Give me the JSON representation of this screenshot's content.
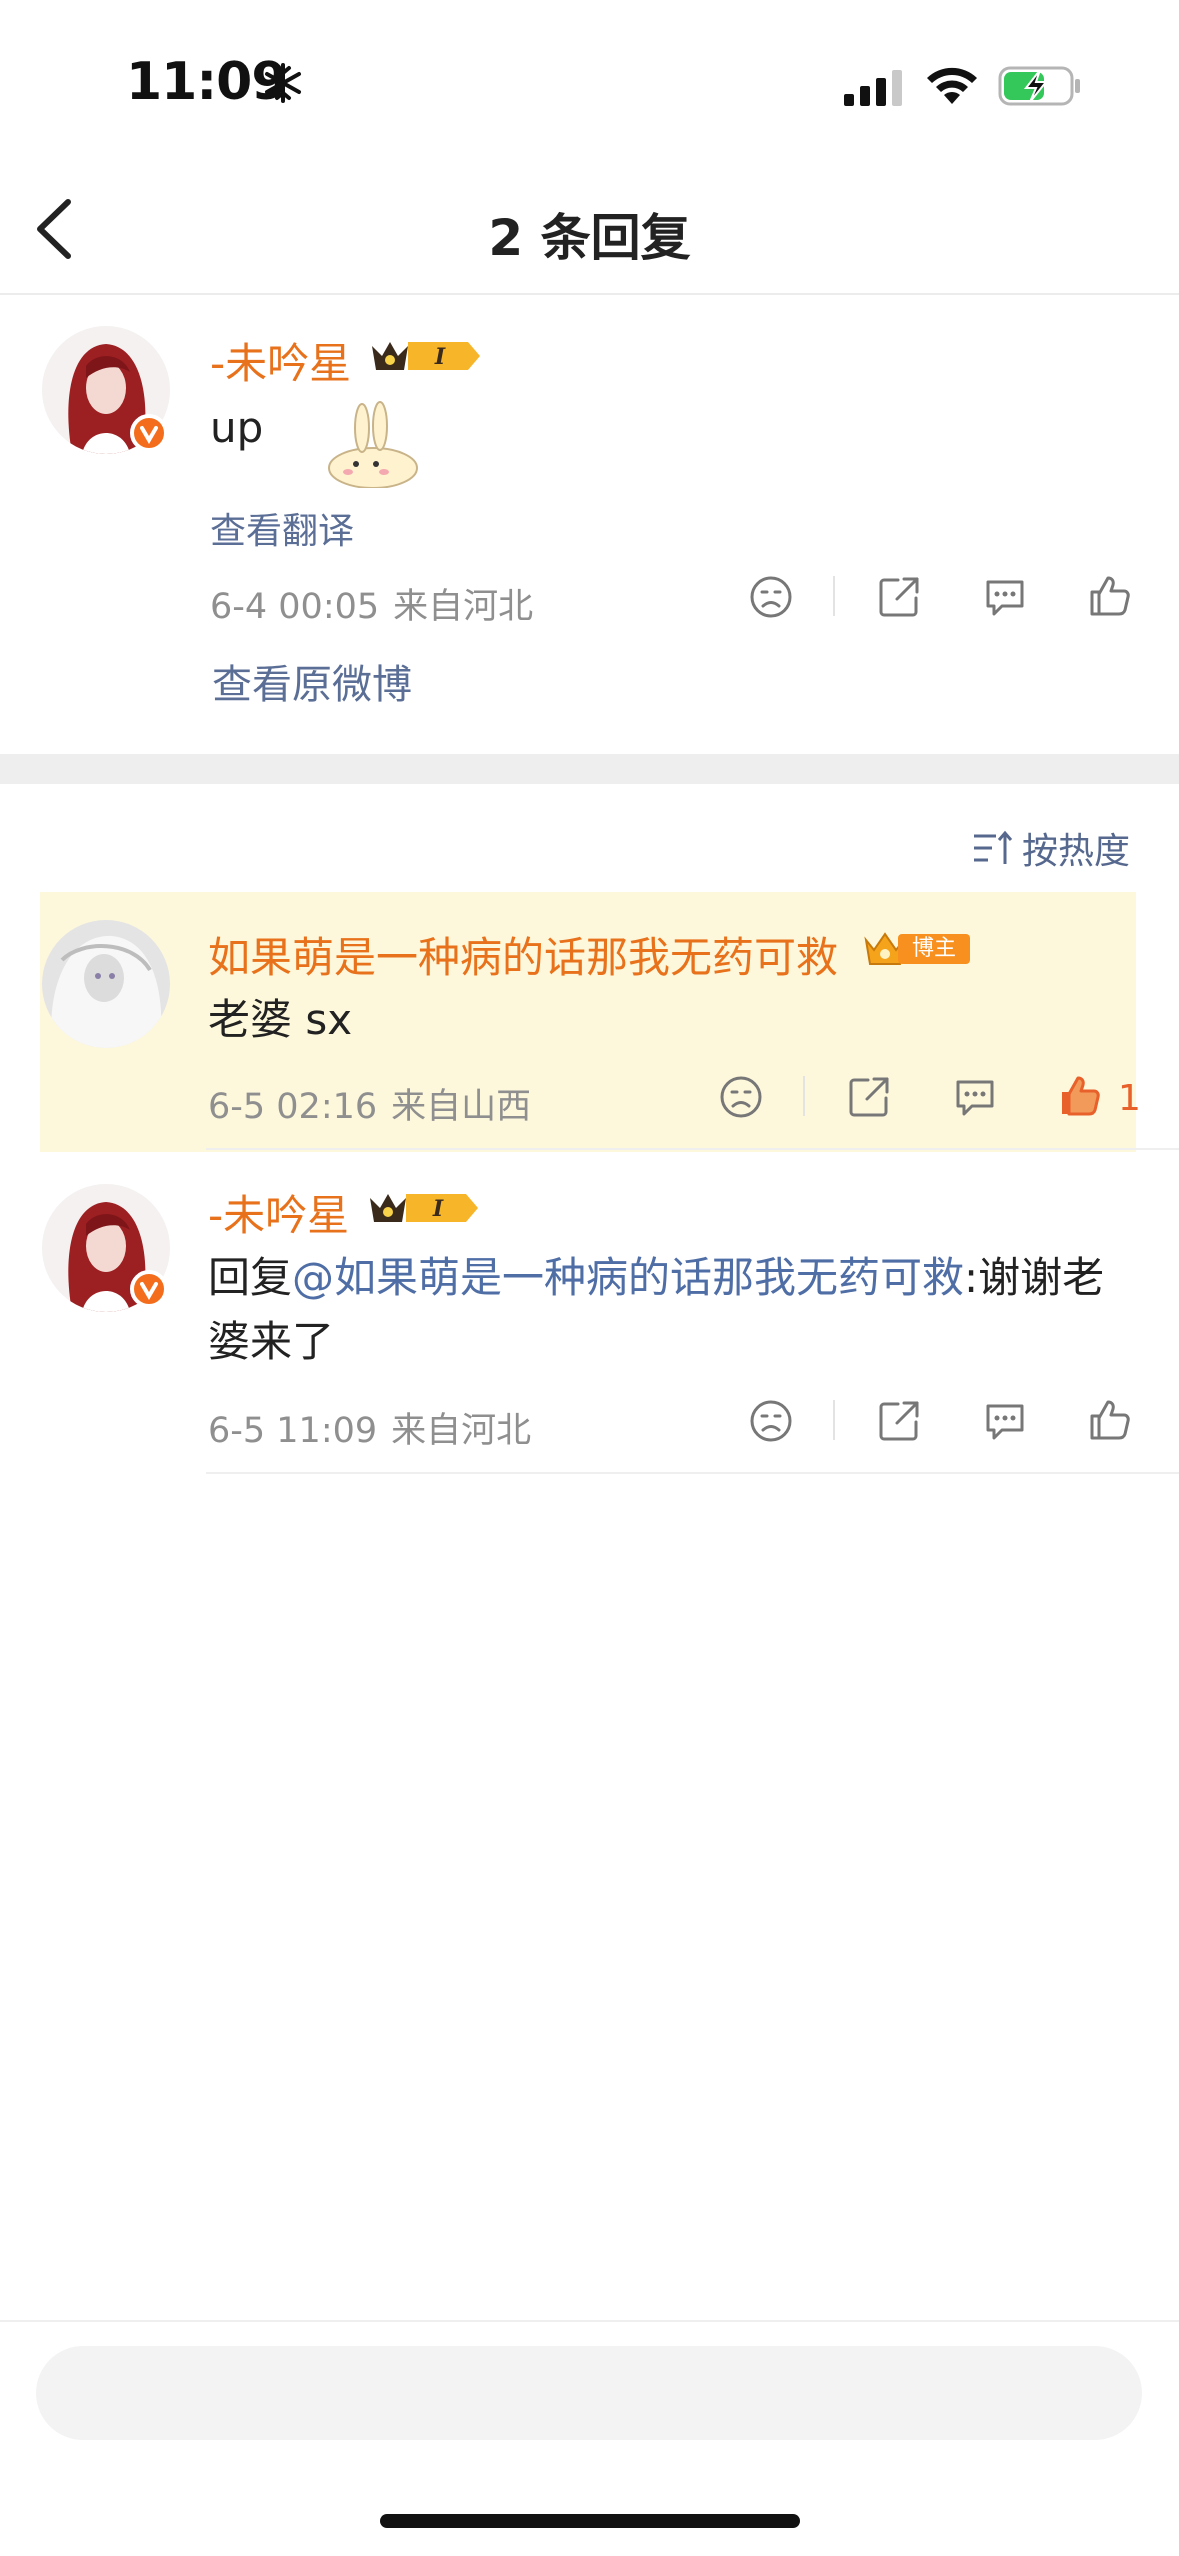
{
  "status_bar": {
    "time": "11:09"
  },
  "nav": {
    "title": "2 条回复"
  },
  "original_comment": {
    "username": "-未吟星",
    "rank_badge": "I",
    "text": "up",
    "translate_label": "查看翻译",
    "date": "6-4 00:05",
    "location": "来自河北",
    "view_original_label": "查看原微博"
  },
  "sort": {
    "label": "按热度"
  },
  "replies": [
    {
      "username": "如果萌是一种病的话那我无药可救",
      "badge": "博主",
      "text": "老婆 sx",
      "date": "6-5 02:16",
      "location": "来自山西",
      "like_count": "1"
    },
    {
      "username": "-未吟星",
      "rank_badge": "I",
      "reply_prefix": "回复",
      "mention": "@如果萌是一种病的话那我无药可救",
      "text_rest": ":谢谢老婆来了",
      "date": "6-5 11:09",
      "location": "来自河北"
    }
  ],
  "colors": {
    "username": "#e8721c",
    "link": "#5b6e96",
    "highlight_bg": "#fdf8dc",
    "liked": "#e8602a"
  }
}
